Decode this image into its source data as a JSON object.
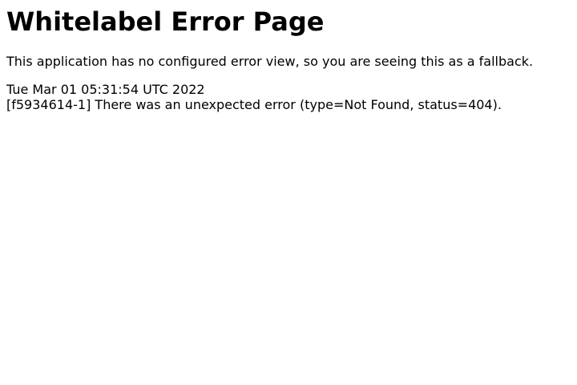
{
  "page": {
    "title": "Whitelabel Error Page",
    "description": "This application has no configured error view, so you are seeing this as a fallback.",
    "timestamp": "Tue Mar 01 05:31:54 UTC 2022",
    "error_message": "[f5934614-1] There was an unexpected error (type=Not Found, status=404)."
  }
}
